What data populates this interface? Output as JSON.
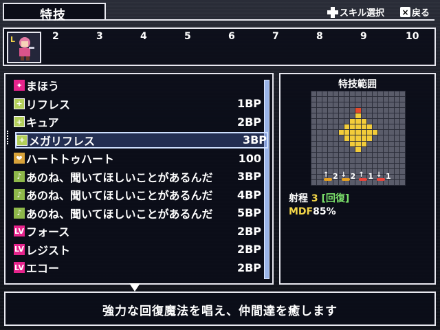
{
  "header": {
    "title": "特技",
    "hint_skill": "スキル選択",
    "hint_back": "戻る",
    "back_button_glyph": "×"
  },
  "party": {
    "leader_badge": "L",
    "slots": [
      "2",
      "3",
      "4",
      "5",
      "6",
      "7",
      "8",
      "9",
      "10"
    ]
  },
  "skills": [
    {
      "name": "まほう",
      "cost": "",
      "icon": "magic-icon"
    },
    {
      "name": "リフレス",
      "cost": "1BP",
      "icon": "heal-icon"
    },
    {
      "name": "キュア",
      "cost": "2BP",
      "icon": "heal-icon"
    },
    {
      "name": "メガリフレス",
      "cost": "3BP",
      "icon": "heal-icon",
      "selected": true
    },
    {
      "name": "ハートトゥハート",
      "cost": "100",
      "icon": "heart-icon"
    },
    {
      "name": "あのね、聞いてほしいことがあるんだ",
      "cost": "3BP",
      "icon": "music-icon"
    },
    {
      "name": "あのね、聞いてほしいことがあるんだ",
      "cost": "4BP",
      "icon": "music-icon"
    },
    {
      "name": "あのね、聞いてほしいことがあるんだ",
      "cost": "5BP",
      "icon": "music-icon"
    },
    {
      "name": "フォース",
      "cost": "2BP",
      "icon": "lv-icon"
    },
    {
      "name": "レジスト",
      "cost": "2BP",
      "icon": "lv-icon"
    },
    {
      "name": "エコー",
      "cost": "2BP",
      "icon": "lv-icon"
    }
  ],
  "range": {
    "title": "特技範囲",
    "dirs": [
      {
        "value": "2",
        "color": "#e6a020"
      },
      {
        "value": "2",
        "color": "#e6a020"
      },
      {
        "value": "1",
        "color": "#e8443a"
      },
      {
        "value": "1",
        "color": "#e8443a"
      }
    ],
    "range_label": "射程",
    "range_value": "3",
    "range_type": "[回復]",
    "mdf_label": "MDF",
    "mdf_value": "85%"
  },
  "description": "強力な回復魔法を唱え、仲間達を癒します",
  "colors": {
    "highlight_yellow": "#f3d548",
    "highlight_green": "#7be06a",
    "grid_yellow": "#f2cc3a",
    "grid_red": "#e44a2a"
  }
}
